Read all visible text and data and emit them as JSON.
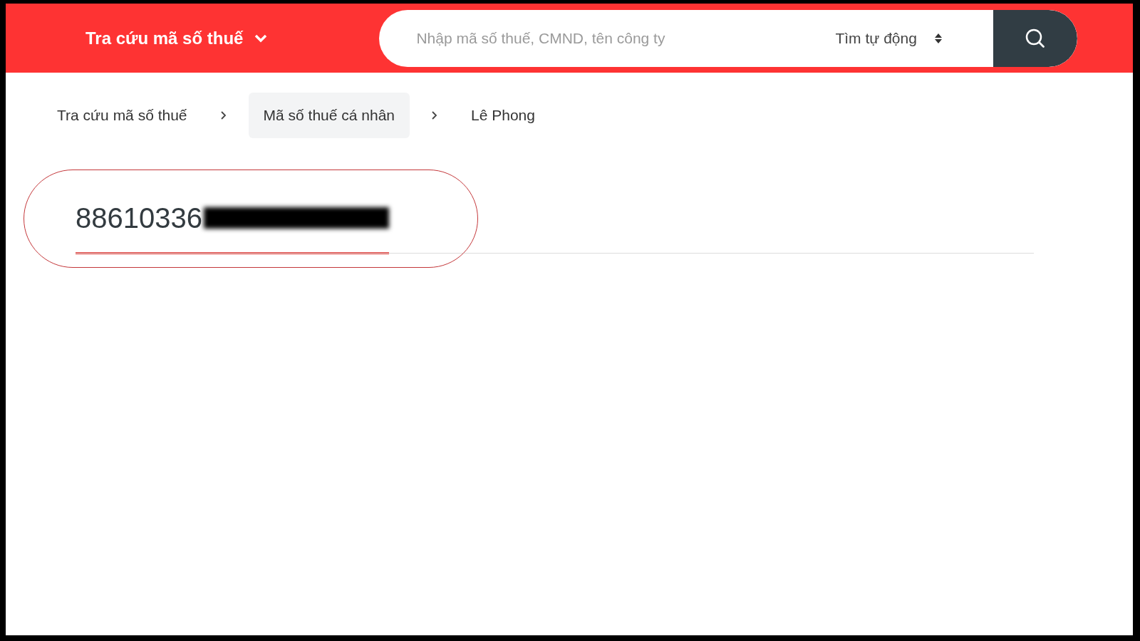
{
  "header": {
    "menu_title": "Tra cứu mã số thuế",
    "search": {
      "placeholder": "Nhập mã số thuế, CMND, tên công ty",
      "mode": "Tìm tự động"
    }
  },
  "breadcrumbs": [
    {
      "label": "Tra cứu mã số thuế",
      "selected": false
    },
    {
      "label": "Mã số thuế cá nhân",
      "selected": true
    },
    {
      "label": "Lê Phong",
      "selected": false
    }
  ],
  "tabs": [
    {
      "label": "88610336",
      "selected": true,
      "redacted": true
    }
  ]
}
